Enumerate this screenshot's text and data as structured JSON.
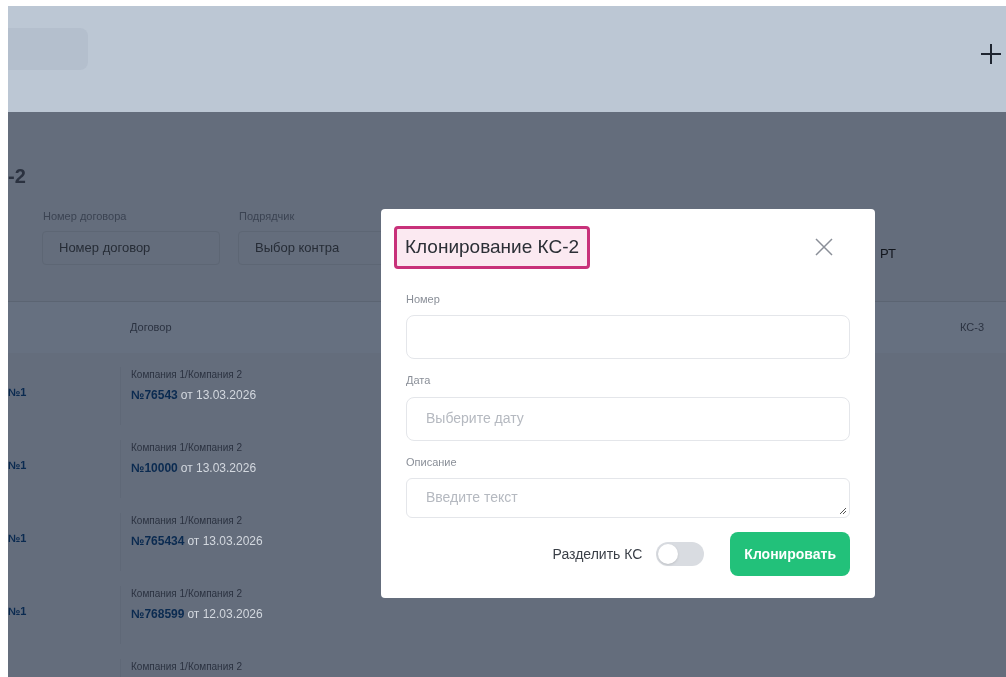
{
  "page": {
    "title": "-2",
    "filters": [
      {
        "label": "Номер договора",
        "placeholder": "Номер договор"
      },
      {
        "label": "Подрядчик",
        "placeholder": "Выбор контра"
      }
    ],
    "filter_cut_text": "РТ"
  },
  "table": {
    "columns": [
      "Договор",
      "КС-3"
    ],
    "rows": [
      {
        "column_1": "№1",
        "company": "Компания 1/Компания 2",
        "number": "№76543",
        "date": "от 13.03.2026"
      },
      {
        "column_1": "№1",
        "company": "Компания 1/Компания 2",
        "number": "№10000",
        "date": "от 13.03.2026"
      },
      {
        "column_1": "№1",
        "company": "Компания 1/Компания 2",
        "number": "№765434",
        "date": "от 13.03.2026"
      },
      {
        "column_1": "№1",
        "company": "Компания 1/Компания 2",
        "number": "№768599",
        "date": "от 12.03.2026"
      },
      {
        "company": "Компания 1/Компания 2"
      }
    ]
  },
  "modal": {
    "title": "Клонирование КС-2",
    "title_highlighted": true,
    "fields": [
      {
        "kind": "input",
        "label": "Номер"
      },
      {
        "kind": "input",
        "label": "Дата",
        "placeholder": "Выберите дату"
      },
      {
        "kind": "textarea",
        "label": "Описание",
        "placeholder": "Введите текст"
      }
    ],
    "toggle": {
      "label": "Разделить КС",
      "on": false
    },
    "button": "Клонировать"
  }
}
